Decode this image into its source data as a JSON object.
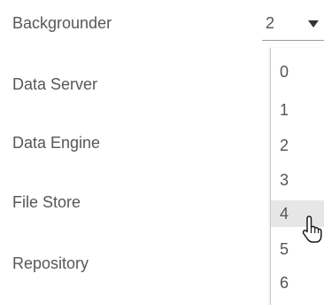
{
  "rows": [
    {
      "label": "Backgrounder"
    },
    {
      "label": "Data Server"
    },
    {
      "label": "Data Engine"
    },
    {
      "label": "File Store"
    },
    {
      "label": "Repository"
    }
  ],
  "select": {
    "selected_value": "2",
    "icon": "chevron-down-icon"
  },
  "dropdown": {
    "options": [
      "0",
      "1",
      "2",
      "3",
      "4",
      "5",
      "6"
    ],
    "hovered_option": "4"
  },
  "cursor": {
    "icon": "pointer-cursor-icon"
  }
}
